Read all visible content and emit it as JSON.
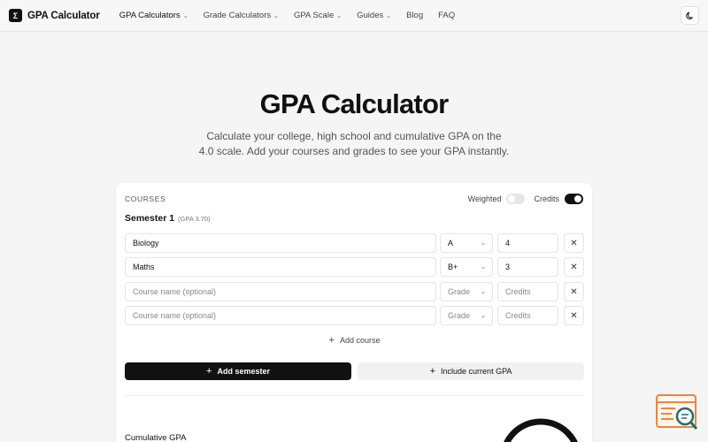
{
  "nav": {
    "logo_glyph": "Σ",
    "logo_text": "GPA Calculator",
    "items": [
      {
        "label": "GPA Calculators",
        "dropdown": true
      },
      {
        "label": "Grade Calculators",
        "dropdown": true
      },
      {
        "label": "GPA Scale",
        "dropdown": true
      },
      {
        "label": "Guides",
        "dropdown": true
      },
      {
        "label": "Blog",
        "dropdown": false
      },
      {
        "label": "FAQ",
        "dropdown": false
      }
    ],
    "theme_icon": "moon-icon"
  },
  "hero": {
    "title": "GPA Calculator",
    "subtitle_line1": "Calculate your college, high school and cumulative GPA on the",
    "subtitle_line2": "4.0 scale. Add your courses and grades to see your GPA instantly."
  },
  "card": {
    "courses_label": "COURSES",
    "weighted_label": "Weighted",
    "weighted_on": false,
    "credits_label": "Credits",
    "credits_on": true,
    "semester": {
      "title": "Semester 1",
      "gpa": "(GPA 3.70)",
      "rows": [
        {
          "course": "Biology",
          "grade": "A",
          "credits": "4"
        },
        {
          "course": "Maths",
          "grade": "B+",
          "credits": "3"
        },
        {
          "course": "",
          "grade": "Grade",
          "credits": ""
        },
        {
          "course": "",
          "grade": "Grade",
          "credits": ""
        }
      ],
      "course_placeholder": "Course name (optional)",
      "credits_placeholder": "Credits"
    },
    "add_course_label": "Add course",
    "add_semester_label": "Add semester",
    "include_current_label": "Include current GPA",
    "cumulative_label": "Cumulative GPA"
  },
  "colors": {
    "accent": "#111111",
    "gauge_track": "#e6e6e6",
    "widget_orange": "#f0843c",
    "widget_teal": "#1f6f6a"
  }
}
